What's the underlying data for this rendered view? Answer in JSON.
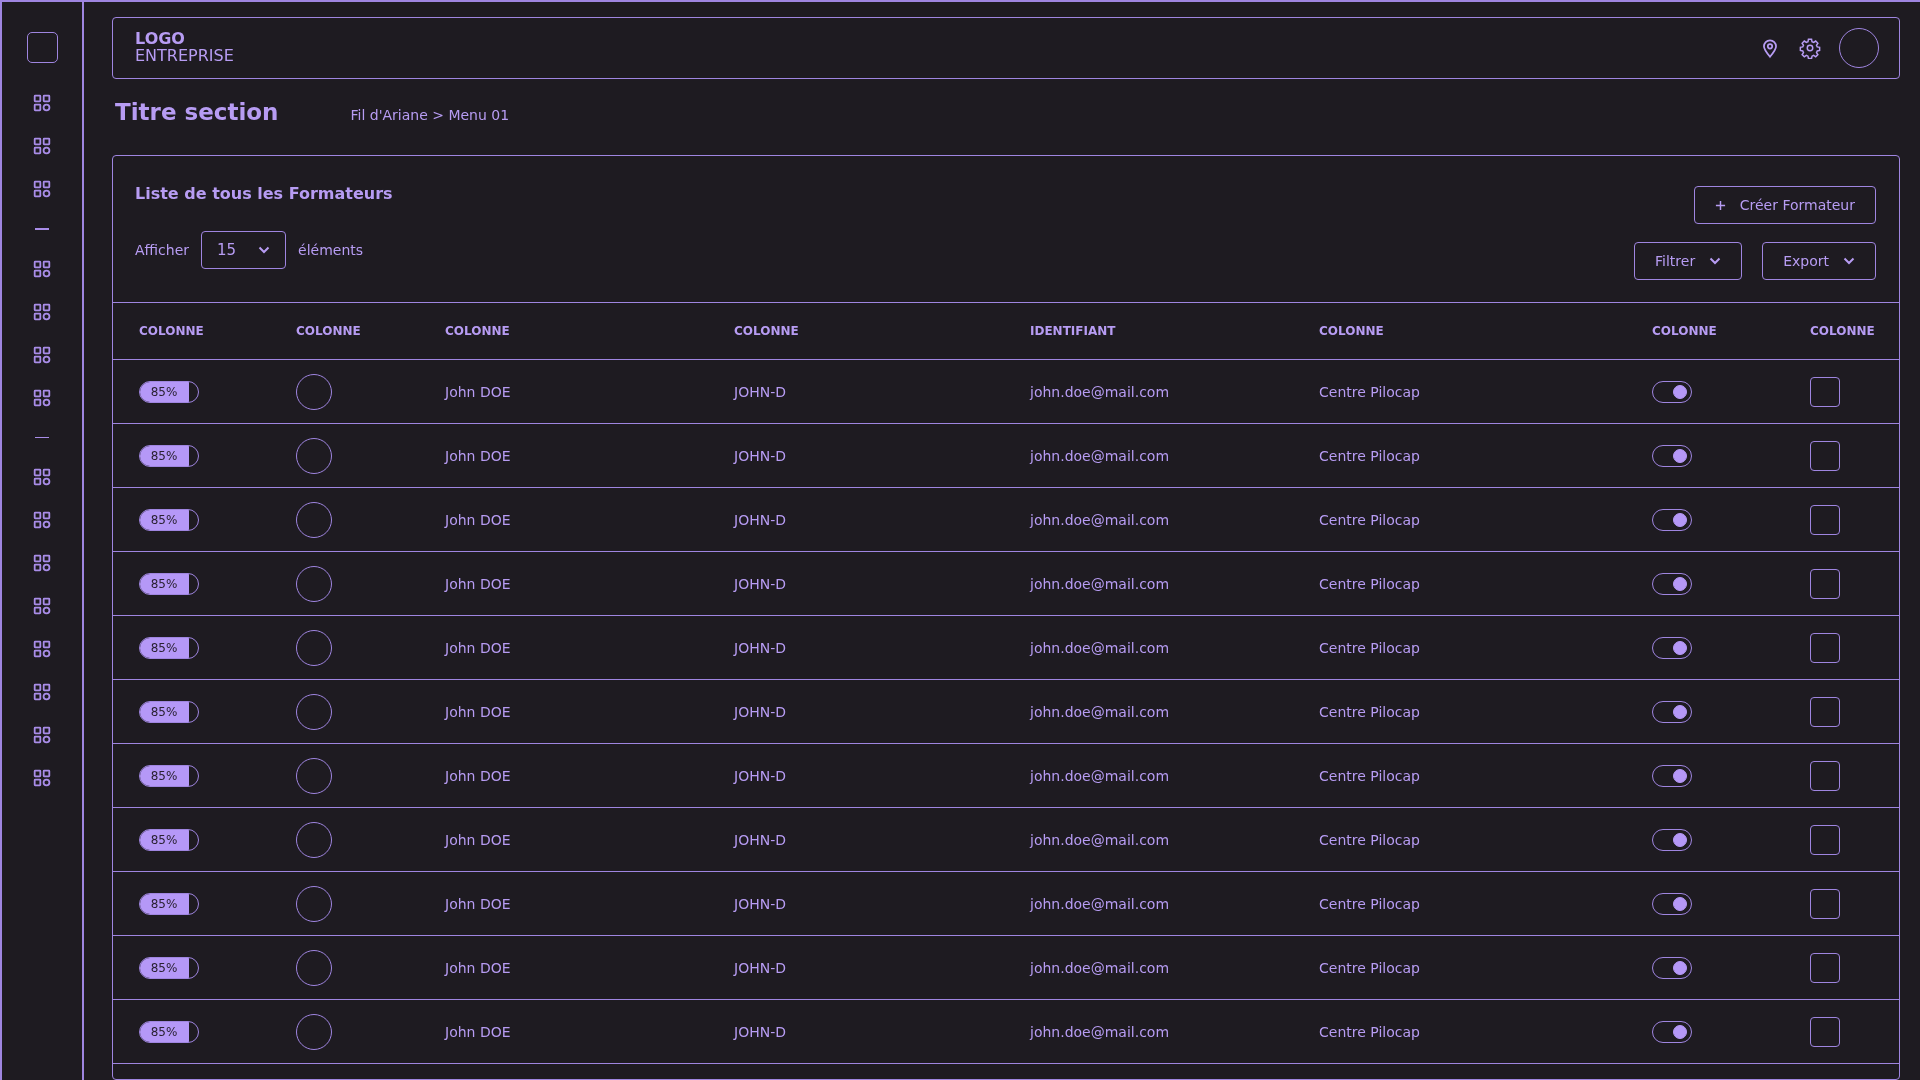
{
  "sidebar": {
    "items": [
      {
        "kind": "grid"
      },
      {
        "kind": "grid"
      },
      {
        "kind": "grid"
      },
      {
        "kind": "divider"
      },
      {
        "kind": "grid"
      },
      {
        "kind": "grid"
      },
      {
        "kind": "grid"
      },
      {
        "kind": "grid"
      },
      {
        "kind": "divider"
      },
      {
        "kind": "grid"
      },
      {
        "kind": "grid"
      },
      {
        "kind": "grid"
      },
      {
        "kind": "grid"
      },
      {
        "kind": "grid"
      },
      {
        "kind": "grid"
      },
      {
        "kind": "grid"
      },
      {
        "kind": "grid"
      }
    ]
  },
  "header": {
    "logo": "LOGO",
    "company": "ENTREPRISE"
  },
  "page": {
    "title": "Titre section",
    "breadcrumb": "Fil d'Ariane > Menu 01"
  },
  "card": {
    "title": "Liste de tous les Formateurs",
    "create_button": "Créer Formateur",
    "show_label": "Afficher",
    "page_size": "15",
    "items_label": "éléments",
    "filter_button": "Filtrer",
    "export_button": "Export"
  },
  "table": {
    "columns": [
      "COLONNE",
      "COLONNE",
      "COLONNE",
      "COLONNE",
      "IDENTIFIANT",
      "COLONNE",
      "COLONNE",
      "COLONNE"
    ],
    "rows": [
      {
        "progress": {
          "level": 0.85,
          "label": "85%"
        },
        "name": "John DOE",
        "code": "JOHN-D",
        "email": "john.doe@mail.com",
        "centre": "Centre Pilocap",
        "on": true,
        "checked": false
      },
      {
        "progress": {
          "level": 0.85,
          "label": "85%"
        },
        "name": "John DOE",
        "code": "JOHN-D",
        "email": "john.doe@mail.com",
        "centre": "Centre Pilocap",
        "on": true,
        "checked": false
      },
      {
        "progress": {
          "level": 0.85,
          "label": "85%"
        },
        "name": "John DOE",
        "code": "JOHN-D",
        "email": "john.doe@mail.com",
        "centre": "Centre Pilocap",
        "on": true,
        "checked": false
      },
      {
        "progress": {
          "level": 0.85,
          "label": "85%"
        },
        "name": "John DOE",
        "code": "JOHN-D",
        "email": "john.doe@mail.com",
        "centre": "Centre Pilocap",
        "on": true,
        "checked": false
      },
      {
        "progress": {
          "level": 0.85,
          "label": "85%"
        },
        "name": "John DOE",
        "code": "JOHN-D",
        "email": "john.doe@mail.com",
        "centre": "Centre Pilocap",
        "on": true,
        "checked": false
      },
      {
        "progress": {
          "level": 0.85,
          "label": "85%"
        },
        "name": "John DOE",
        "code": "JOHN-D",
        "email": "john.doe@mail.com",
        "centre": "Centre Pilocap",
        "on": true,
        "checked": false
      },
      {
        "progress": {
          "level": 0.85,
          "label": "85%"
        },
        "name": "John DOE",
        "code": "JOHN-D",
        "email": "john.doe@mail.com",
        "centre": "Centre Pilocap",
        "on": true,
        "checked": false
      },
      {
        "progress": {
          "level": 0.85,
          "label": "85%"
        },
        "name": "John DOE",
        "code": "JOHN-D",
        "email": "john.doe@mail.com",
        "centre": "Centre Pilocap",
        "on": true,
        "checked": false
      },
      {
        "progress": {
          "level": 0.85,
          "label": "85%"
        },
        "name": "John DOE",
        "code": "JOHN-D",
        "email": "john.doe@mail.com",
        "centre": "Centre Pilocap",
        "on": true,
        "checked": false
      },
      {
        "progress": {
          "level": 0.85,
          "label": "85%"
        },
        "name": "John DOE",
        "code": "JOHN-D",
        "email": "john.doe@mail.com",
        "centre": "Centre Pilocap",
        "on": true,
        "checked": false
      },
      {
        "progress": {
          "level": 0.85,
          "label": "85%"
        },
        "name": "John DOE",
        "code": "JOHN-D",
        "email": "john.doe@mail.com",
        "centre": "Centre Pilocap",
        "on": true,
        "checked": false
      }
    ]
  }
}
